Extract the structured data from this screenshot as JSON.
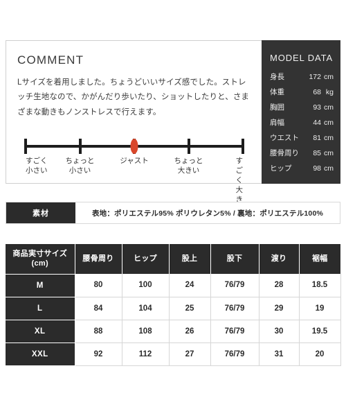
{
  "comment": {
    "title": "COMMENT",
    "body": "Lサイズを着用しました。ちょうどいいサイズ感でした。ストレッチ生地なので、かがんだり歩いたり、ショットしたりと、さまざまな動きもノンストレスで行えます。"
  },
  "scale": {
    "marker_index": 2,
    "marker_color": "#d9472b",
    "axis_color": "#1d1d1d",
    "labels": [
      "すごく\n小さい",
      "ちょっと\n小さい",
      "ジャスト",
      "ちょっと\n大きい",
      "すごく\n大きい"
    ]
  },
  "model_data": {
    "title": "MODEL DATA",
    "background": "#333333",
    "rows": [
      {
        "label": "身長",
        "value": "172",
        "unit": "cm"
      },
      {
        "label": "体重",
        "value": "68",
        "unit": "kg"
      },
      {
        "label": "胸囲",
        "value": "93",
        "unit": "cm"
      },
      {
        "label": "肩幅",
        "value": "44",
        "unit": "cm"
      },
      {
        "label": "ウエスト",
        "value": "81",
        "unit": "cm"
      },
      {
        "label": "腰骨周り",
        "value": "85",
        "unit": "cm"
      },
      {
        "label": "ヒップ",
        "value": "98",
        "unit": "cm"
      }
    ]
  },
  "material": {
    "label": "素材",
    "value": "表地：ポリエステル95% ポリウレタン5% / 裏地：ポリエステル100%"
  },
  "size_table": {
    "headers": [
      "商品実寸サイズ\n(cm)",
      "腰骨周り",
      "ヒップ",
      "股上",
      "股下",
      "渡り",
      "裾幅"
    ],
    "rows": [
      {
        "size": "M",
        "cells": [
          "80",
          "100",
          "24",
          "76/79",
          "28",
          "18.5"
        ]
      },
      {
        "size": "L",
        "cells": [
          "84",
          "104",
          "25",
          "76/79",
          "29",
          "19"
        ]
      },
      {
        "size": "XL",
        "cells": [
          "88",
          "108",
          "26",
          "76/79",
          "30",
          "19.5"
        ]
      },
      {
        "size": "XXL",
        "cells": [
          "92",
          "112",
          "27",
          "76/79",
          "31",
          "20"
        ]
      }
    ]
  }
}
